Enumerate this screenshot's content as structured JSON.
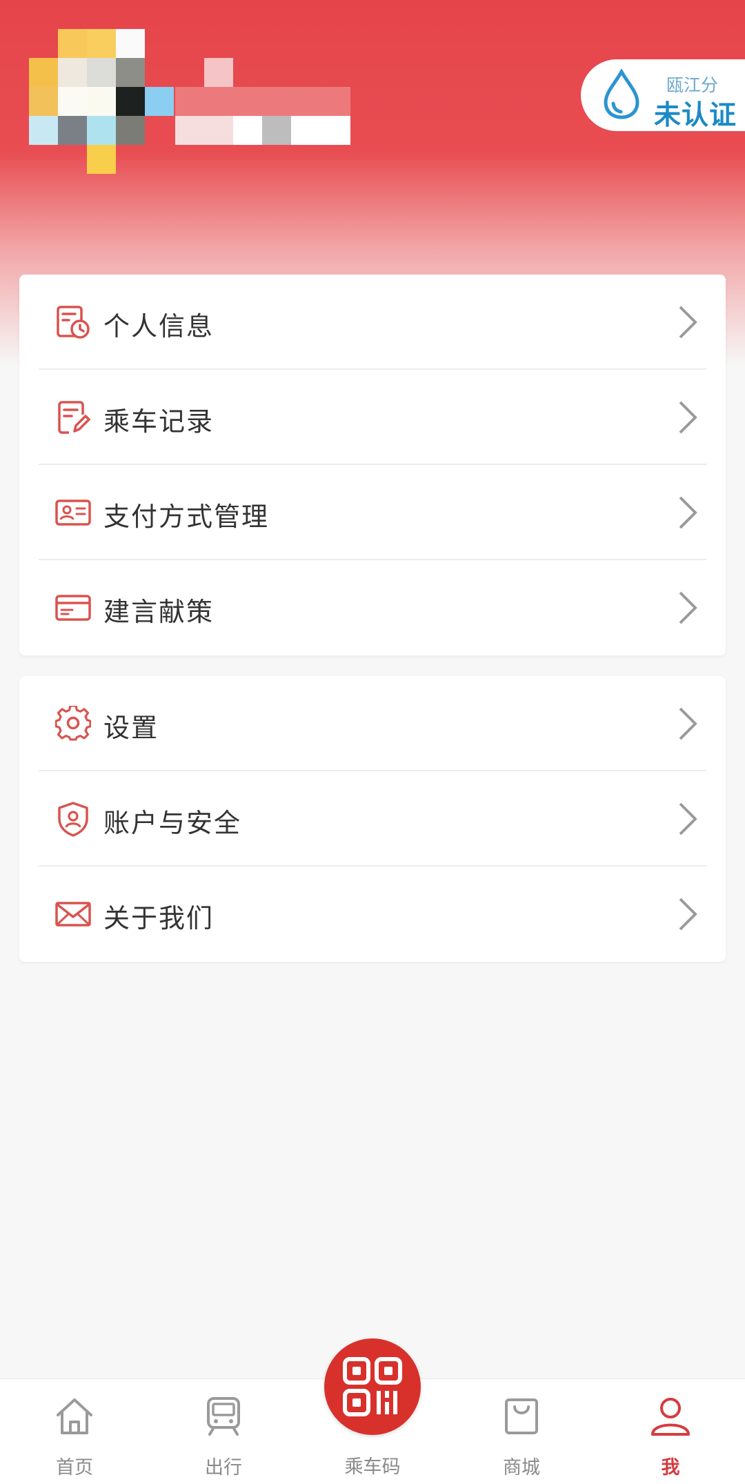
{
  "profile": {
    "badge_title": "瓯江分",
    "badge_status": "未认证"
  },
  "menu_group_1": [
    {
      "label": "个人信息",
      "icon": "personal-info-icon"
    },
    {
      "label": "乘车记录",
      "icon": "ride-record-icon"
    },
    {
      "label": "支付方式管理",
      "icon": "payment-card-icon"
    },
    {
      "label": "建言献策",
      "icon": "suggestion-icon"
    }
  ],
  "menu_group_2": [
    {
      "label": "设置",
      "icon": "gear-icon"
    },
    {
      "label": "账户与安全",
      "icon": "shield-icon"
    },
    {
      "label": "关于我们",
      "icon": "mail-icon"
    }
  ],
  "tabbar": {
    "home": "首页",
    "travel": "出行",
    "ride_code": "乘车码",
    "mall": "商城",
    "me": "我"
  },
  "colors": {
    "brand_red": "#d8312b",
    "header_red": "#e5454a",
    "icon_red": "#d9534f",
    "badge_blue": "#1c8ac6"
  }
}
